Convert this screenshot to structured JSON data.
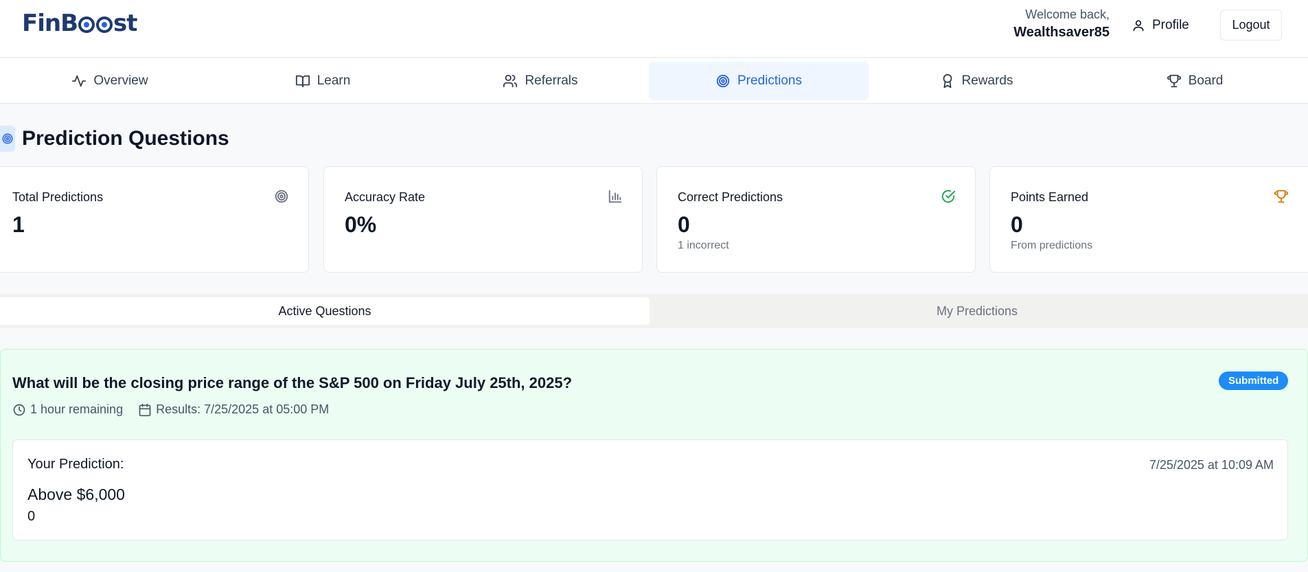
{
  "header": {
    "logo_left": "FinB",
    "logo_right": "st",
    "welcome": "Welcome back,",
    "username": "Wealthsaver85",
    "profile_label": "Profile",
    "logout_label": "Logout"
  },
  "nav": {
    "items": [
      {
        "label": "Overview",
        "icon": "activity-icon"
      },
      {
        "label": "Learn",
        "icon": "book-icon"
      },
      {
        "label": "Referrals",
        "icon": "users-icon"
      },
      {
        "label": "Predictions",
        "icon": "target-icon",
        "active": true
      },
      {
        "label": "Rewards",
        "icon": "award-icon"
      },
      {
        "label": "Board",
        "icon": "trophy-icon"
      }
    ]
  },
  "page": {
    "title": "Prediction Questions"
  },
  "stats": [
    {
      "label": "Total Predictions",
      "value": "1",
      "sub": "",
      "icon": "target-icon",
      "color": "#6b7280"
    },
    {
      "label": "Accuracy Rate",
      "value": "0%",
      "sub": "",
      "icon": "bar-chart-icon",
      "color": "#6b7280"
    },
    {
      "label": "Correct Predictions",
      "value": "0",
      "sub": "1 incorrect",
      "icon": "check-circle-icon",
      "color": "#16a34a"
    },
    {
      "label": "Points Earned",
      "value": "0",
      "sub": "From predictions",
      "icon": "trophy-icon",
      "color": "#d97706"
    }
  ],
  "subtabs": {
    "active": "Active Questions",
    "inactive": "My Predictions"
  },
  "question": {
    "title": "What will be the closing price range of the S&P 500 on Friday July 25th, 2025?",
    "status": "Submitted",
    "remaining": "1 hour remaining",
    "results": "Results: 7/25/2025 at 05:00 PM",
    "prediction_label": "Your Prediction:",
    "prediction_date": "7/25/2025 at 10:09 AM",
    "prediction_value": "Above $6,000",
    "prediction_number": "0"
  },
  "colors": {
    "accent": "#2563eb",
    "brand": "#1e3a6e",
    "badge": "#1d8cf8",
    "question_bg": "#ecfdf3"
  }
}
